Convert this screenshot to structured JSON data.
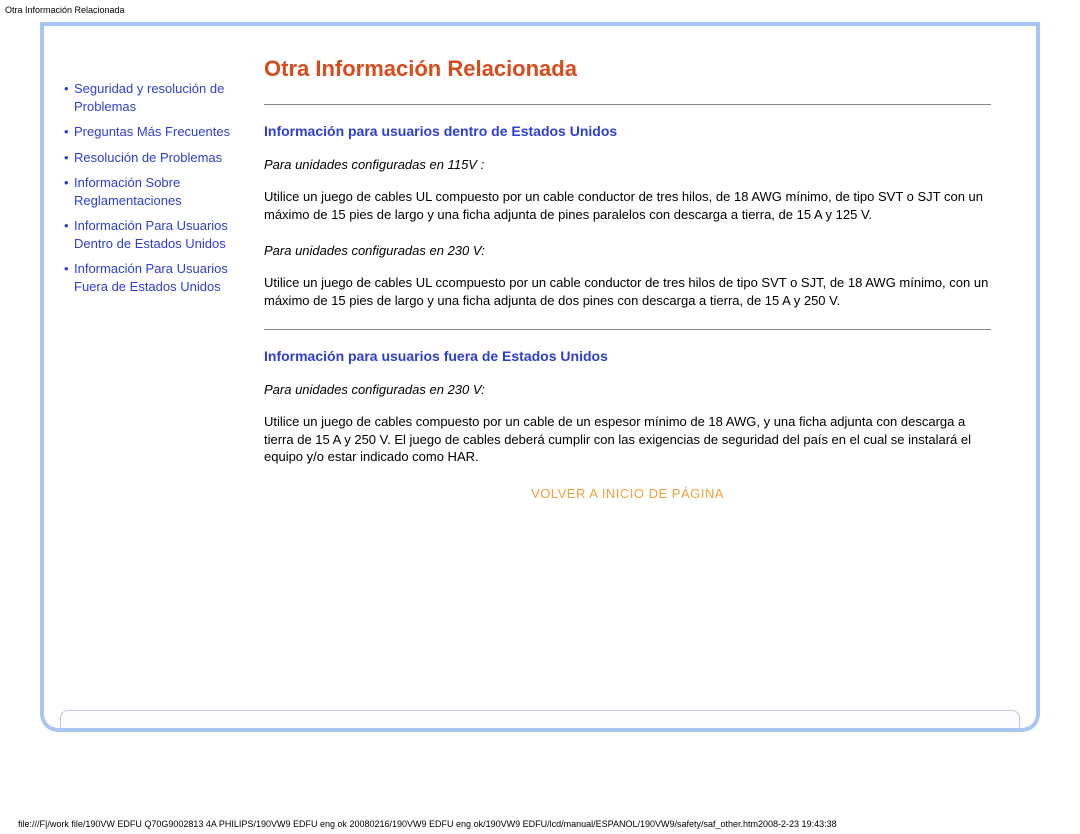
{
  "header": "Otra Información Relacionada",
  "sidebar": {
    "items": [
      {
        "label": "Seguridad y resolución de Problemas"
      },
      {
        "label": "Preguntas Más Frecuentes"
      },
      {
        "label": "Resolución de Problemas"
      },
      {
        "label": "Información Sobre Reglamentaciones"
      },
      {
        "label": "Información Para Usuarios Dentro de Estados Unidos"
      },
      {
        "label": "Información Para Usuarios Fuera de Estados Unidos"
      }
    ]
  },
  "main": {
    "title": "Otra Información Relacionada",
    "section1": {
      "heading": "Información para usuarios dentro de Estados Unidos",
      "sub1": "Para unidades configuradas en 115V :",
      "para1": "Utilice un juego de cables UL compuesto por un cable conductor de tres hilos, de 18 AWG mínimo, de tipo SVT o SJT con un máximo de 15 pies de largo y una ficha adjunta de pines paralelos con descarga a tierra, de 15 A y 125 V.",
      "sub2": "Para unidades configuradas en 230 V:",
      "para2": "Utilice un juego de cables UL ccompuesto por un cable conductor de tres hilos de tipo SVT o SJT, de 18 AWG mínimo, con un máximo de 15 pies de largo y una ficha adjunta de dos pines con descarga a tierra, de 15 A y 250 V."
    },
    "section2": {
      "heading": "Información para usuarios fuera de Estados Unidos",
      "sub1": "Para unidades configuradas en 230 V:",
      "para1": "Utilice un juego de cables compuesto por un cable de un espesor mínimo de 18 AWG, y una ficha adjunta con descarga a tierra de 15 A y 250 V. El juego de cables deberá cumplir con las exigencias de seguridad del país en el cual se instalará el equipo y/o estar indicado como HAR."
    },
    "backToTop": "VOLVER A INICIO DE PÁGINA"
  },
  "footer": "file:///F|/work file/190VW EDFU Q70G9002813 4A PHILIPS/190VW9 EDFU eng ok 20080216/190VW9 EDFU eng ok/190VW9 EDFU/lcd/manual/ESPANOL/190VW9/safety/saf_other.htm2008-2-23 19:43:38"
}
